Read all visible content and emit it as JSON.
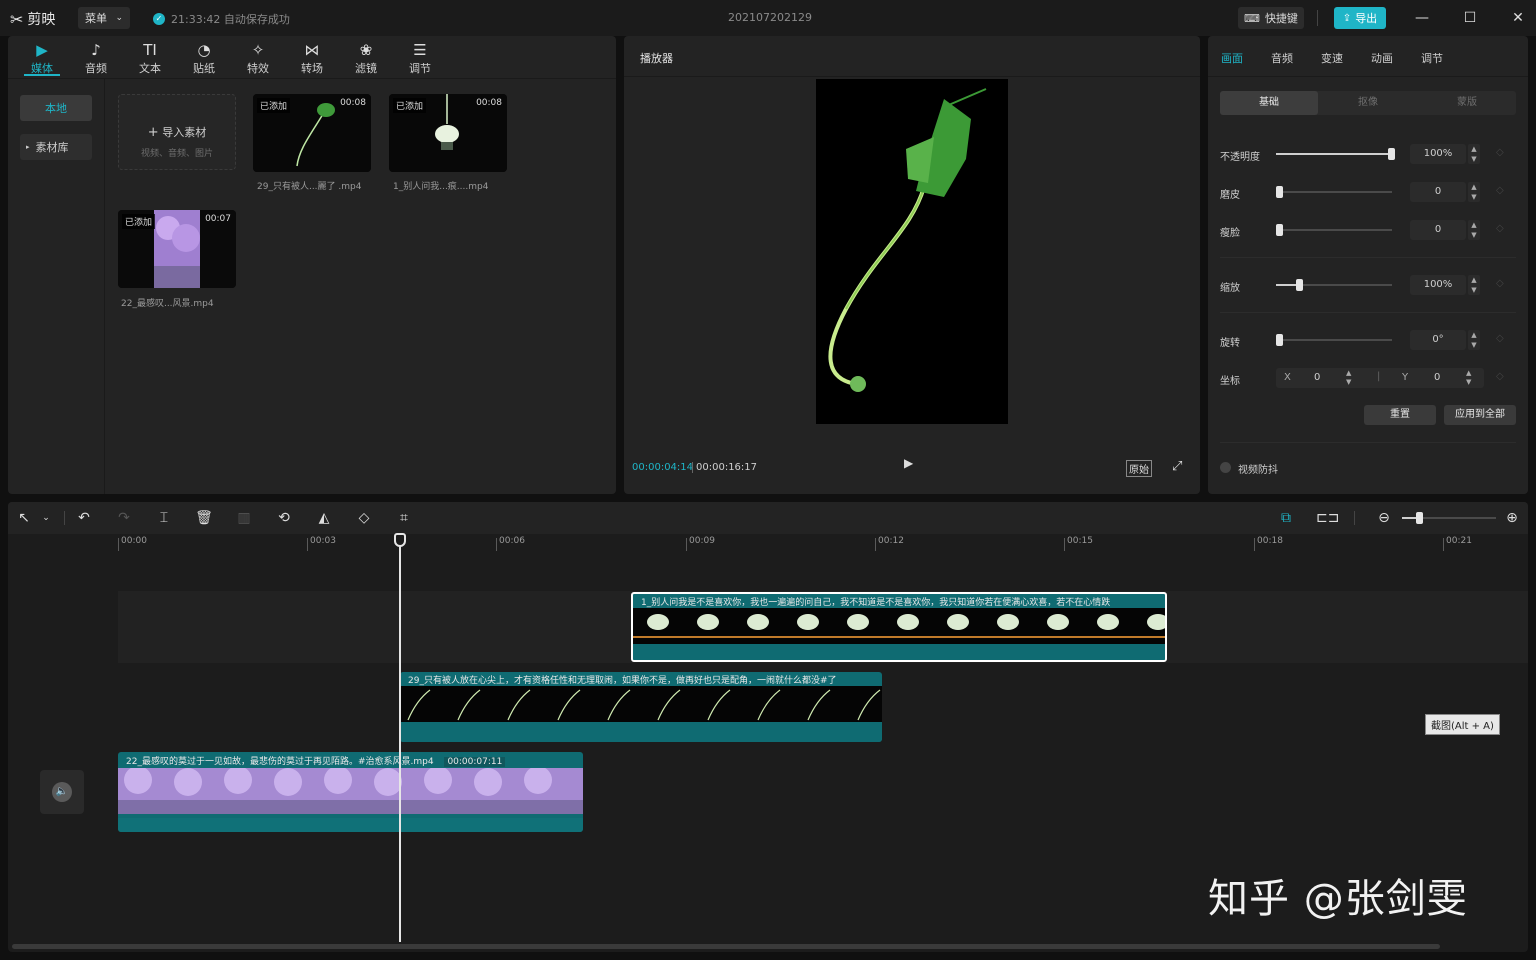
{
  "titlebar": {
    "app_name": "剪映",
    "menu_label": "菜单",
    "autosave": "21:33:42 自动保存成功",
    "project_name": "202107202129",
    "shortcut_label": "快捷键",
    "export_label": "导出"
  },
  "media": {
    "tools": [
      {
        "label": "媒体",
        "icon": "▶"
      },
      {
        "label": "音频",
        "icon": "♪"
      },
      {
        "label": "文本",
        "icon": "TI"
      },
      {
        "label": "贴纸",
        "icon": "◔"
      },
      {
        "label": "特效",
        "icon": "✧"
      },
      {
        "label": "转场",
        "icon": "⋈"
      },
      {
        "label": "滤镜",
        "icon": "❀"
      },
      {
        "label": "调节",
        "icon": "☰"
      }
    ],
    "side": {
      "local": "本地",
      "library": "素材库"
    },
    "import": {
      "label": "导入素材",
      "sub": "视频、音频、图片"
    },
    "items": [
      {
        "badge": "已添加",
        "duration": "00:08",
        "name": "29_只有被人...麗了 .mp4"
      },
      {
        "badge": "已添加",
        "duration": "00:08",
        "name": "1_别人问我...痕....mp4"
      },
      {
        "badge": "已添加",
        "duration": "00:07",
        "name": "22_最感叹...风景.mp4"
      }
    ]
  },
  "player": {
    "title": "播放器",
    "current_time": "00:00:04:14",
    "total_time": "00:00:16:17",
    "original_label": "原始"
  },
  "props": {
    "tabs": [
      "画面",
      "音频",
      "变速",
      "动画",
      "调节"
    ],
    "segments": [
      "基础",
      "抠像",
      "蒙版"
    ],
    "opacity": {
      "label": "不透明度",
      "value": "100%",
      "level": 1.0
    },
    "smooth": {
      "label": "磨皮",
      "value": "0",
      "level": 0
    },
    "slim": {
      "label": "瘦脸",
      "value": "0",
      "level": 0
    },
    "scale": {
      "label": "缩放",
      "value": "100%",
      "level": 0.2
    },
    "rotate": {
      "label": "旋转",
      "value": "0°",
      "level": 0
    },
    "position": {
      "label": "坐标",
      "x_label": "X",
      "x": "0",
      "y_label": "Y",
      "y": "0"
    },
    "reset_label": "重置",
    "apply_all_label": "应用到全部",
    "stabilize_label": "视频防抖"
  },
  "timeline": {
    "ruler": [
      "00:00",
      "00:03",
      "00:06",
      "00:09",
      "00:12",
      "00:15",
      "00:18",
      "00:21"
    ],
    "clips": [
      {
        "title": "1_别人问我是不是喜欢你，我也一遍遍的问自己，我不知道是不是喜欢你，我只知道你若在便满心欢喜，若不在心情跌"
      },
      {
        "title": "29_只有被人放在心尖上，才有资格任性和无理取闹，如果你不是，做再好也只是配角，一闹就什么都没#了"
      },
      {
        "title": "22_最感叹的莫过于一见如故，最悲伤的莫过于再见陌路。#治愈系风景.mp4",
        "duration": "00:00:07:11"
      }
    ],
    "tooltip": "截图(Alt + A)"
  },
  "watermark": "知乎 @张剑雯"
}
